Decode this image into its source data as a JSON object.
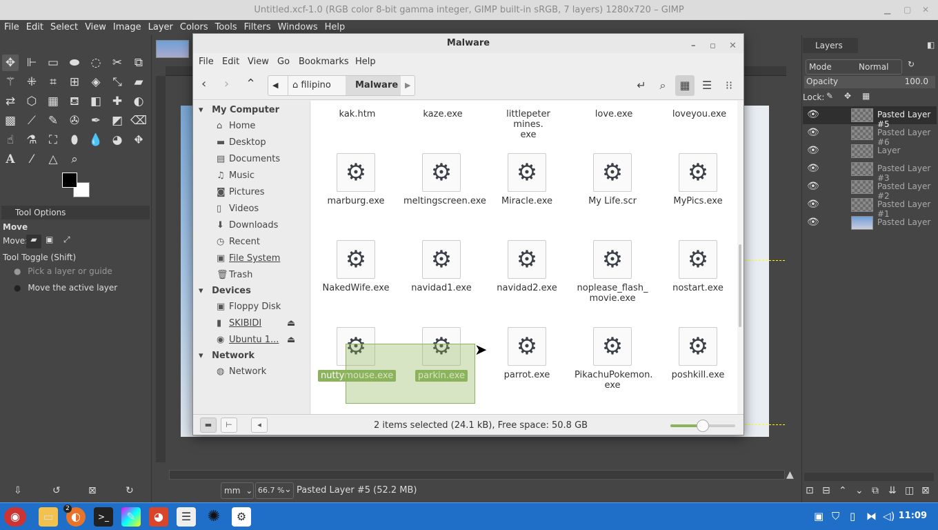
{
  "gimp": {
    "title": "Untitled.xcf-1.0 (RGB color 8-bit gamma integer, GIMP built-in sRGB, 7 layers) 1280x720 – GIMP",
    "menu": [
      "File",
      "Edit",
      "Select",
      "View",
      "Image",
      "Layer",
      "Colors",
      "Tools",
      "Filters",
      "Windows",
      "Help"
    ],
    "tool_options": {
      "tab_label": "Tool Options",
      "tool_name": "Move",
      "move_label": "Move:",
      "toggle_label": "Tool Toggle  (Shift)",
      "option1": "Pick a layer or guide",
      "option2": "Move the active layer"
    },
    "status": {
      "unit": "mm",
      "zoom": "66.7 %",
      "text": "Pasted Layer #5 (52.2 MB)"
    },
    "layers": {
      "tab_label": "Layers",
      "mode_label": "Mode",
      "mode_value": "Normal",
      "opacity_label": "Opacity",
      "opacity_value": "100.0",
      "lock_label": "Lock:",
      "items": [
        "Pasted Layer #5",
        "Pasted Layer #6",
        "Layer",
        "Pasted Layer #3",
        "Pasted Layer #2",
        "Pasted Layer #1",
        "Pasted Layer"
      ]
    }
  },
  "file_manager": {
    "title": "Malware",
    "menu": [
      "File",
      "Edit",
      "View",
      "Go",
      "Bookmarks",
      "Help"
    ],
    "breadcrumbs": [
      "filipino",
      "Malware"
    ],
    "sidebar": {
      "my_computer": "My Computer",
      "places": [
        "Home",
        "Desktop",
        "Documents",
        "Music",
        "Pictures",
        "Videos",
        "Downloads",
        "Recent",
        "File System",
        "Trash"
      ],
      "devices_head": "Devices",
      "devices": [
        "Floppy Disk",
        "SKIBIDI",
        "Ubuntu 1..."
      ],
      "network_head": "Network",
      "network": [
        "Network"
      ]
    },
    "files_row0": [
      "kak.htm",
      "kaze.exe",
      "littlepeter mines.\nexe",
      "love.exe",
      "loveyou.exe"
    ],
    "files_row1": [
      "marburg.exe",
      "meltingscreen.exe",
      "Miracle.exe",
      "My Life.scr",
      "MyPics.exe"
    ],
    "files_row2": [
      "NakedWife.exe",
      "navidad1.exe",
      "navidad2.exe",
      "noplease_flash_\nmovie.exe",
      "nostart.exe"
    ],
    "files_row3": [
      "nuttymouse.exe",
      "parkin.exe",
      "parrot.exe",
      "PikachuPokemon.\nexe",
      "poshkill.exe"
    ],
    "status": "2 items selected (24.1 kB), Free space: 50.8 GB"
  },
  "taskbar": {
    "time": "11:09",
    "badge": "2"
  }
}
